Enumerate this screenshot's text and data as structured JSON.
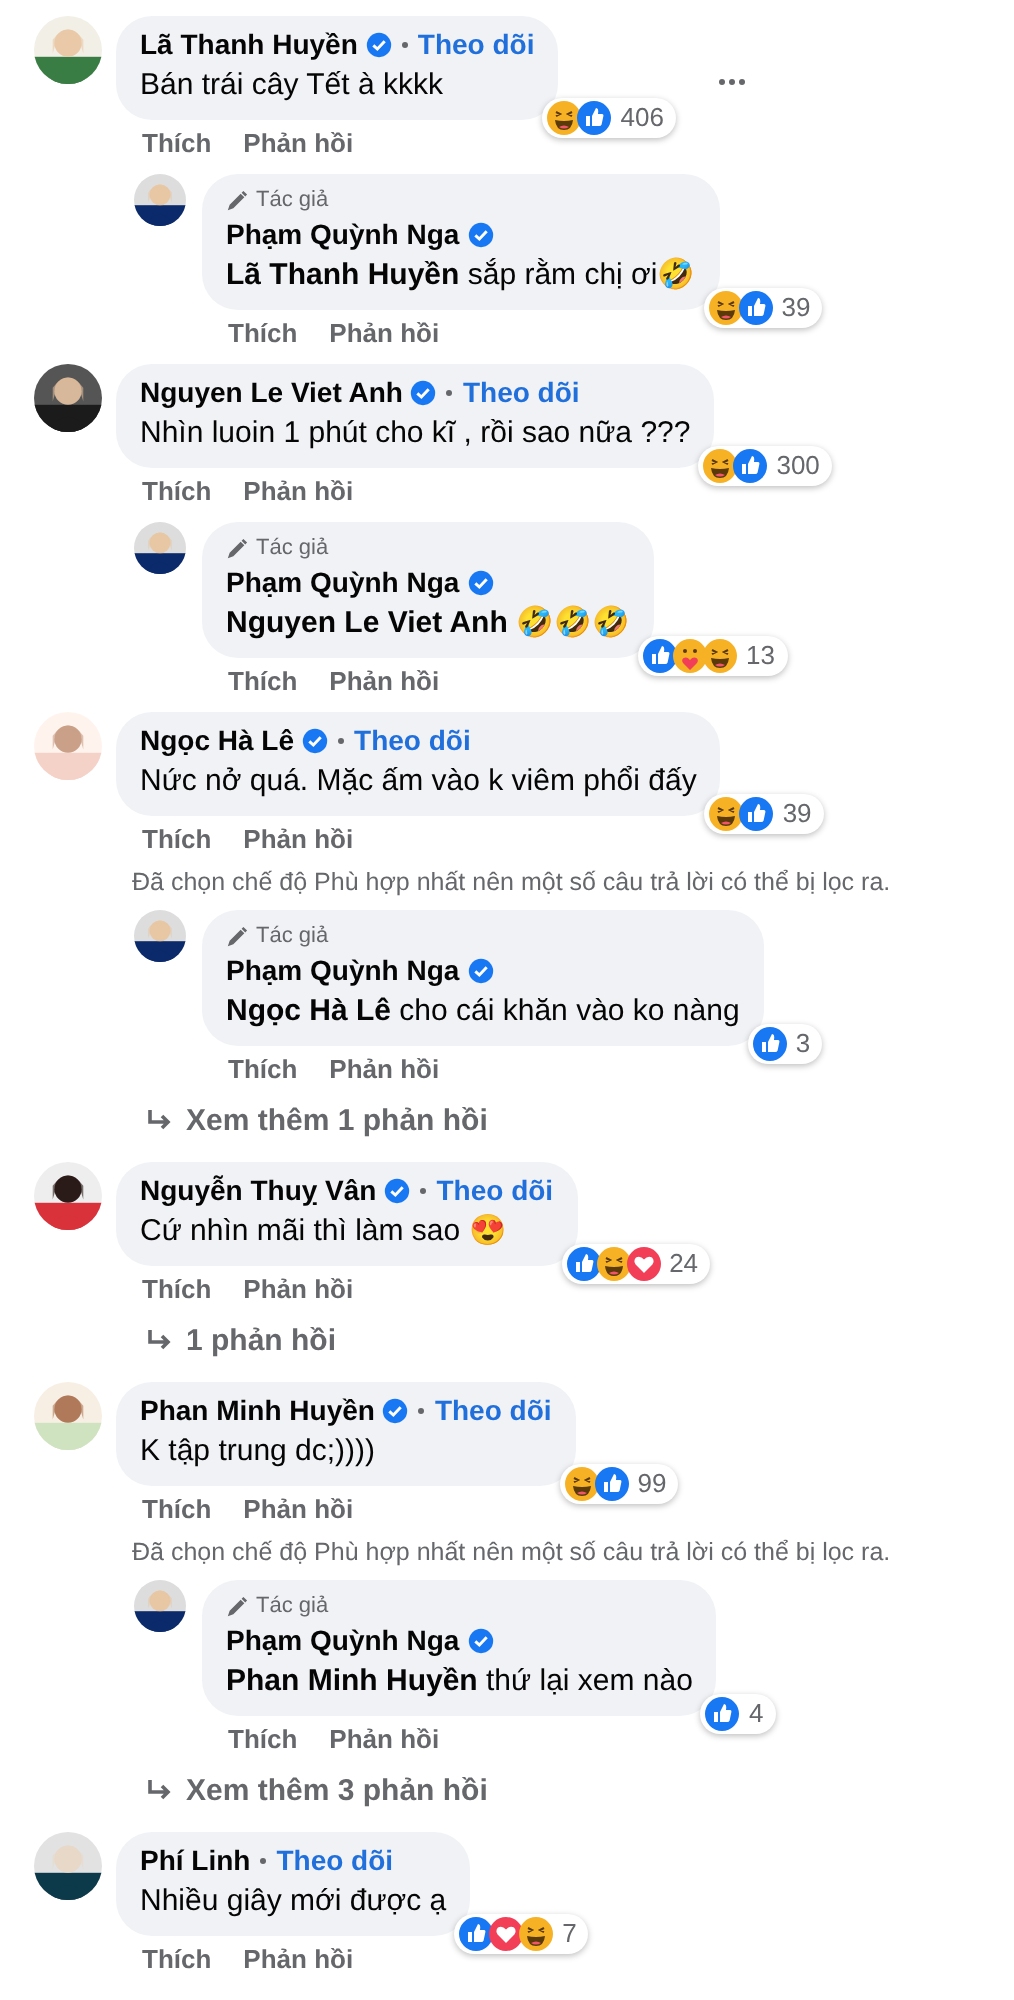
{
  "comments": [
    {
      "author": "Lã Thanh Huyền",
      "verified": true,
      "follow": "Theo dõi",
      "text": "Bán trái cây Tết à kkkk",
      "menu_visible": true,
      "reactions": {
        "types": [
          {
            "kind": "haha"
          },
          {
            "kind": "like"
          }
        ],
        "count": "406"
      },
      "actions": [
        "Thích",
        "Phản hồi"
      ],
      "replies": [
        {
          "badge": "Tác giả",
          "author": "Phạm Quỳnh Nga",
          "verified": true,
          "text": "**Lã Thanh Huyền** sắp rằm chị ơi🤣",
          "reactions": {
            "types": [
              {
                "kind": "haha"
              },
              {
                "kind": "like"
              }
            ],
            "count": "39"
          },
          "actions": [
            "Thích",
            "Phản hồi"
          ]
        }
      ]
    },
    {
      "author": "Nguyen Le Viet Anh",
      "verified": true,
      "follow": "Theo dõi",
      "text": "Nhìn luoin 1 phút cho kĩ , rồi sao nữa ???",
      "menu_visible": false,
      "reactions": {
        "types": [
          {
            "kind": "haha"
          },
          {
            "kind": "like"
          }
        ],
        "count": "300"
      },
      "actions": [
        "Thích",
        "Phản hồi"
      ],
      "replies": [
        {
          "badge": "Tác giả",
          "author": "Phạm Quỳnh Nga",
          "verified": true,
          "text": "**Nguyen Le Viet Anh** 🤣🤣🤣",
          "reactions": {
            "types": [
              {
                "kind": "like"
              },
              {
                "kind": "care"
              },
              {
                "kind": "haha"
              }
            ],
            "count": "13"
          },
          "actions": [
            "Thích",
            "Phản hồi"
          ]
        }
      ]
    },
    {
      "author": "Ngọc Hà Lê",
      "verified": true,
      "follow": "Theo dõi",
      "text": "Nức nở quá. Mặc ấm vào k viêm phổi đấy",
      "menu_visible": false,
      "reactions": {
        "types": [
          {
            "kind": "haha"
          },
          {
            "kind": "like"
          }
        ],
        "count": "39"
      },
      "actions": [
        "Thích",
        "Phản hồi"
      ],
      "notice": "Đã chọn chế độ Phù hợp nhất nên một số câu trả lời có thể bị lọc ra.",
      "replies": [
        {
          "badge": "Tác giả",
          "author": "Phạm Quỳnh Nga",
          "verified": true,
          "text": "**Ngọc Hà Lê** cho cái khăn vào ko nàng",
          "reactions": {
            "types": [
              {
                "kind": "like"
              }
            ],
            "count": "3"
          },
          "actions": [
            "Thích",
            "Phản hồi"
          ]
        }
      ],
      "more_replies": "Xem thêm 1 phản hồi"
    },
    {
      "author": "Nguyễn Thuỵ Vân",
      "verified": true,
      "follow": "Theo dõi",
      "text": "Cứ nhìn mãi thì làm sao 😍",
      "menu_visible": false,
      "reactions": {
        "types": [
          {
            "kind": "like"
          },
          {
            "kind": "haha"
          },
          {
            "kind": "love"
          }
        ],
        "count": "24"
      },
      "actions": [
        "Thích",
        "Phản hồi"
      ],
      "more_replies": "1 phản hồi"
    },
    {
      "author": "Phan Minh Huyền",
      "verified": true,
      "follow": "Theo dõi",
      "text": "K tập trung dc;))))",
      "menu_visible": false,
      "reactions": {
        "types": [
          {
            "kind": "haha"
          },
          {
            "kind": "like"
          }
        ],
        "count": "99"
      },
      "actions": [
        "Thích",
        "Phản hồi"
      ],
      "notice": "Đã chọn chế độ Phù hợp nhất nên một số câu trả lời có thể bị lọc ra.",
      "replies": [
        {
          "badge": "Tác giả",
          "author": "Phạm Quỳnh Nga",
          "verified": true,
          "text": "**Phan Minh Huyền** thứ lại xem nào",
          "reactions": {
            "types": [
              {
                "kind": "like"
              }
            ],
            "count": "4"
          },
          "actions": [
            "Thích",
            "Phản hồi"
          ]
        }
      ],
      "more_replies": "Xem thêm 3 phản hồi"
    },
    {
      "author": "Phí Linh",
      "verified": false,
      "follow": "Theo dõi",
      "text": "Nhiều giây mới được ạ",
      "menu_visible": false,
      "reactions": {
        "types": [
          {
            "kind": "like"
          },
          {
            "kind": "love"
          },
          {
            "kind": "haha"
          }
        ],
        "count": "7"
      },
      "actions": [
        "Thích",
        "Phản hồi"
      ]
    }
  ]
}
